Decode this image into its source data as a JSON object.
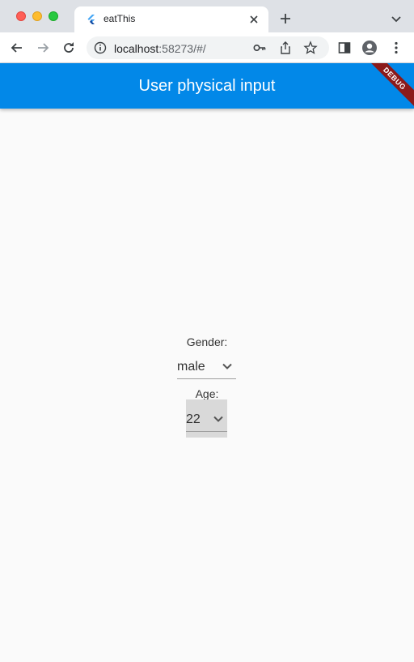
{
  "browser": {
    "tab_title": "eatThis",
    "url_host": "localhost",
    "url_rest": ":58273/#/"
  },
  "app": {
    "title": "User physical input",
    "debug_label": "DEBUG",
    "accent_color": "#0288e8"
  },
  "form": {
    "gender_label": "Gender:",
    "gender_value": "male",
    "age_label": "Age:",
    "age_value": "22"
  },
  "icons": [
    "flutter-icon",
    "close-icon",
    "plus-icon",
    "chevron-down-icon",
    "back-icon",
    "forward-icon",
    "reload-icon",
    "info-icon",
    "key-icon",
    "share-icon",
    "star-icon",
    "sidebar-icon",
    "profile-icon",
    "menu-icon"
  ]
}
